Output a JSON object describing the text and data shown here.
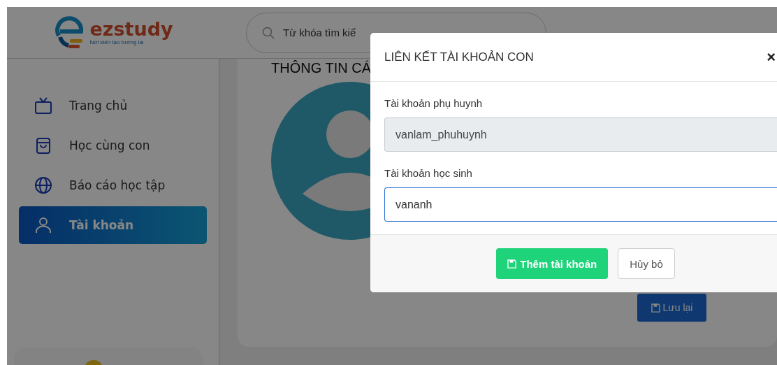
{
  "header": {
    "logo_text": "ezstudy",
    "logo_tagline": "Nơi kiến tạo tương lai",
    "search": {
      "placeholder": "Từ khóa tìm kiế"
    }
  },
  "sidebar": {
    "items": [
      {
        "label": "Trang chủ",
        "selected": false
      },
      {
        "label": "Học cùng con",
        "selected": false
      },
      {
        "label": "Báo cáo học tập",
        "selected": false
      },
      {
        "label": "Tài khoản",
        "selected": true
      }
    ]
  },
  "main": {
    "title": "THÔNG TIN CÁ",
    "save_button": "Lưu lại"
  },
  "modal": {
    "title": "LIÊN KẾT TÀI KHOẢN CON",
    "close": "×",
    "fields": [
      {
        "label": "Tài khoản phụ huynh",
        "value": "vanlam_phuhuynh",
        "disabled": true,
        "focused": false
      },
      {
        "label": "Tài khoản học sinh",
        "value": "vananh",
        "disabled": false,
        "focused": true
      }
    ],
    "buttons": [
      {
        "label": "Thêm tài khoản",
        "kind": "primary"
      },
      {
        "label": "Hủy bỏ",
        "kind": "secondary"
      }
    ]
  }
}
